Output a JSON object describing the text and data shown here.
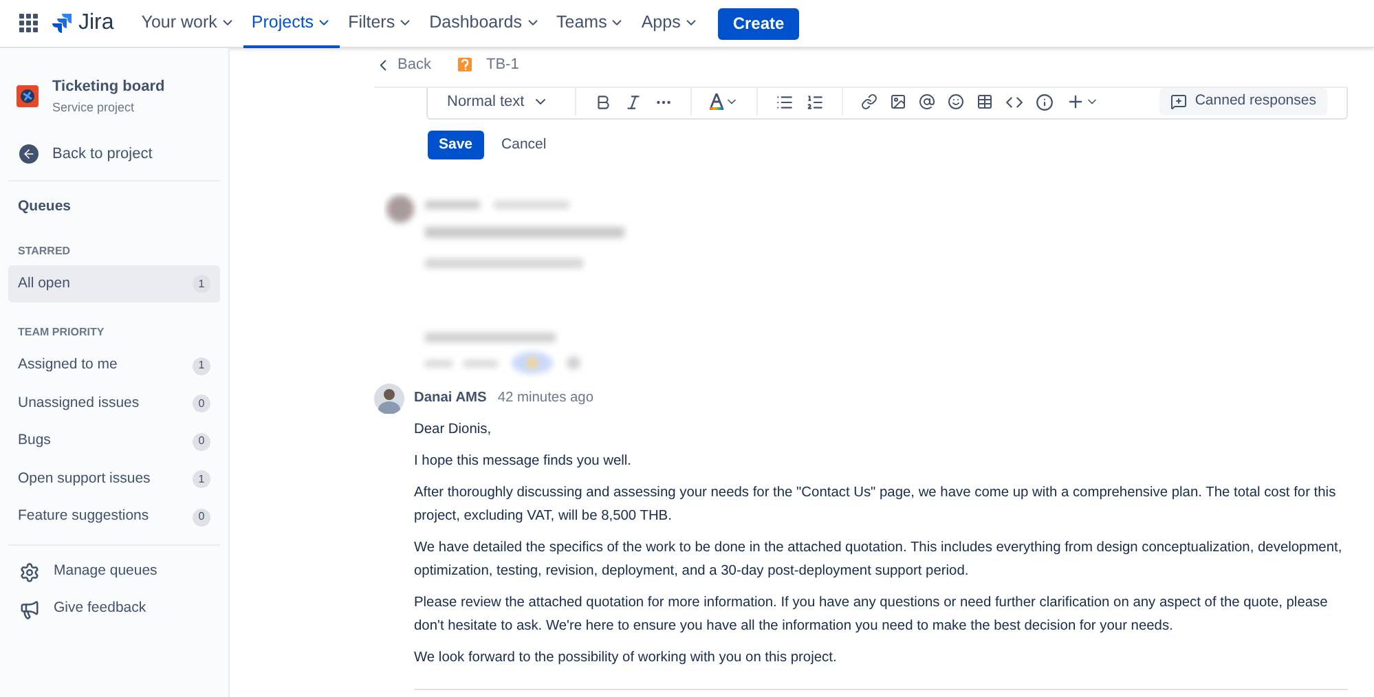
{
  "topbar": {
    "product": "Jira",
    "nav": [
      {
        "label": "Your work",
        "selected": false
      },
      {
        "label": "Projects",
        "selected": true
      },
      {
        "label": "Filters",
        "selected": false
      },
      {
        "label": "Dashboards",
        "selected": false
      },
      {
        "label": "Teams",
        "selected": false
      },
      {
        "label": "Apps",
        "selected": false
      }
    ],
    "create": "Create"
  },
  "sidebar": {
    "project": {
      "name": "Ticketing board",
      "type": "Service project"
    },
    "back": "Back to project",
    "heading": "Queues",
    "groups": [
      {
        "title": "STARRED",
        "items": [
          {
            "label": "All open",
            "count": "1",
            "selected": true
          }
        ]
      },
      {
        "title": "TEAM PRIORITY",
        "items": [
          {
            "label": "Assigned to me",
            "count": "1",
            "selected": false
          },
          {
            "label": "Unassigned issues",
            "count": "0",
            "selected": false
          },
          {
            "label": "Bugs",
            "count": "0",
            "selected": false
          },
          {
            "label": "Open support issues",
            "count": "1",
            "selected": false
          },
          {
            "label": "Feature suggestions",
            "count": "0",
            "selected": false
          }
        ]
      }
    ],
    "footer": [
      {
        "kind": "gear",
        "label": "Manage queues"
      },
      {
        "kind": "megaphone",
        "label": "Give feedback"
      }
    ]
  },
  "breadcrumb": {
    "back": "Back",
    "issue": "TB-1"
  },
  "editor": {
    "text_style": "Normal text",
    "canned_responses": "Canned responses",
    "save": "Save",
    "cancel": "Cancel"
  },
  "comment": {
    "author": "Danai AMS",
    "time": "42 minutes ago",
    "paragraphs": [
      "Dear Dionis,",
      "I hope this message finds you well.",
      "After thoroughly discussing and assessing your needs for the \"Contact Us\" page, we have come up with a comprehensive plan. The total cost for this project, excluding VAT, will be 8,500 THB.",
      "We have detailed the specifics of the work to be done in the attached quotation. This includes everything from design conceptualization, development, optimization, testing, revision, deployment, and a 30-day post-deployment support period.",
      "Please review the attached quotation for more information. If you have any questions or need further clarification on any aspect of the quote, please don't hesitate to ask. We're here to ensure you have all the information you need to make the best decision for your needs.",
      "We look forward to the possibility of working with you on this project."
    ]
  }
}
